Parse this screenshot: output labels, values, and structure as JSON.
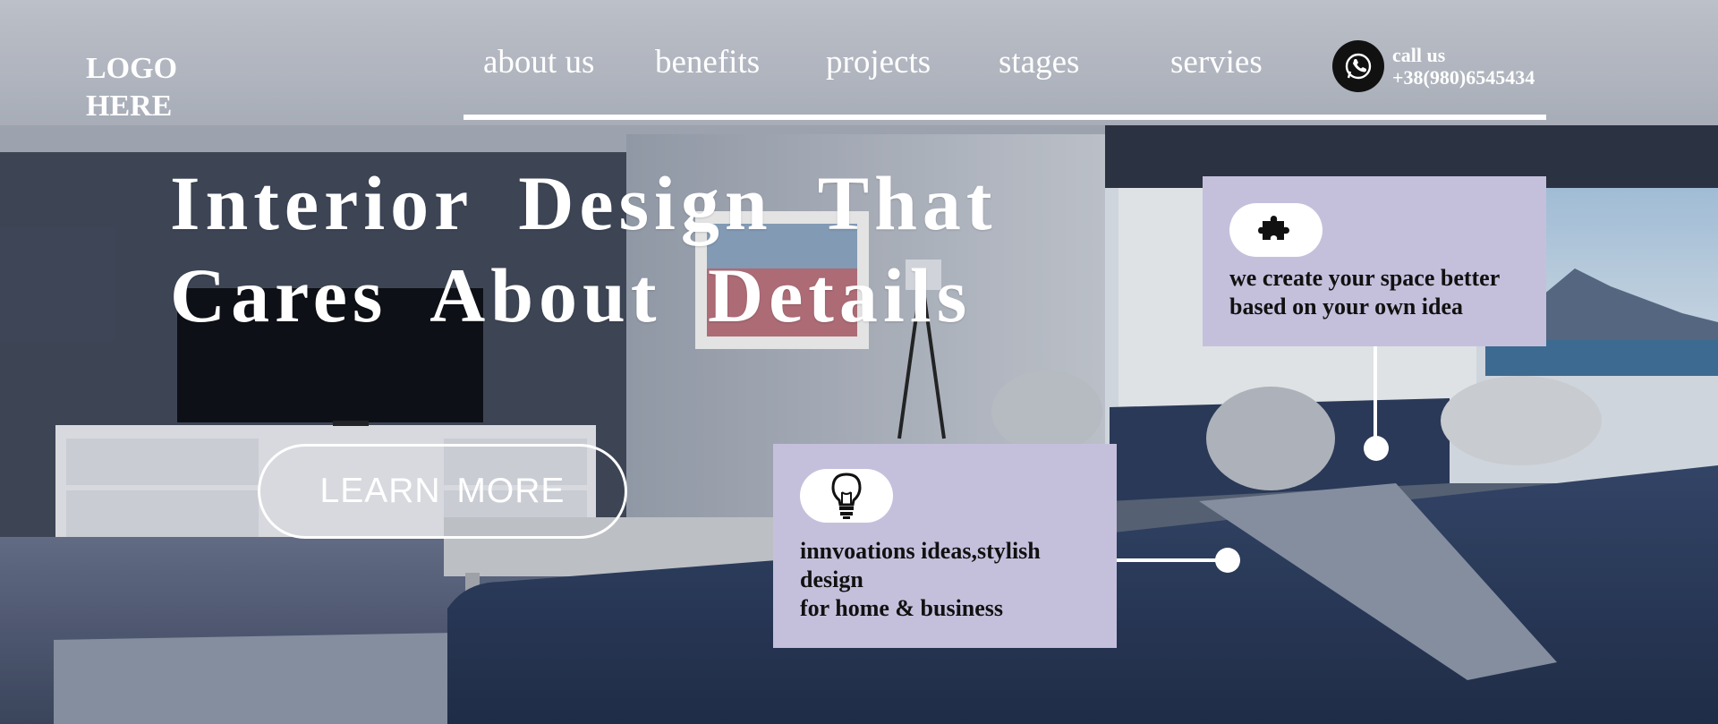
{
  "logo": {
    "line1": "LOGO",
    "line2": "HERE"
  },
  "nav": {
    "items": [
      {
        "label": "about us"
      },
      {
        "label": "benefits"
      },
      {
        "label": "projects"
      },
      {
        "label": "stages"
      },
      {
        "label": "servies"
      }
    ]
  },
  "contact": {
    "icon": "whatsapp-icon",
    "label": "call us",
    "phone": "+38(980)6545434"
  },
  "hero": {
    "line1": "Interior Design That",
    "line2": "Cares About Details",
    "cta_label": "LEARN MORE"
  },
  "cards": [
    {
      "icon": "puzzle-icon",
      "lines": [
        "we create your space better",
        "based on your own idea"
      ]
    },
    {
      "icon": "lightbulb-icon",
      "lines": [
        "innvoations ideas,stylish",
        "design",
        "for home & business"
      ]
    }
  ],
  "colors": {
    "card_background": "#c4c0dc",
    "text_light": "#ffffff",
    "text_dark": "#111111",
    "icon_circle": "#111111"
  }
}
